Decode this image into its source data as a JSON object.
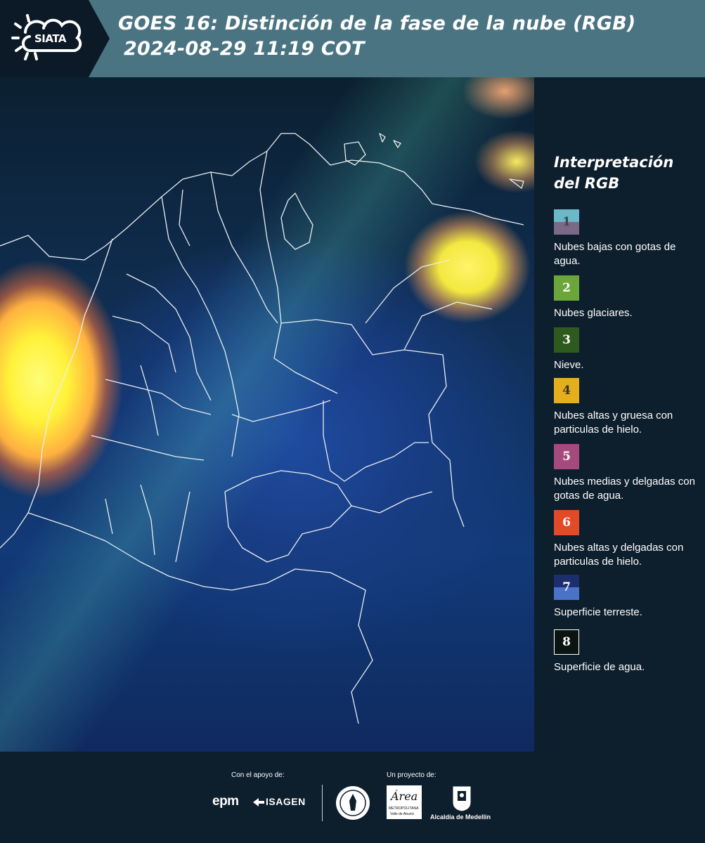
{
  "header": {
    "logo_text": "SIATA",
    "title_line1": "GOES 16: Distinción de la fase de la nube (RGB)",
    "title_line2": "2024-08-29 11:19 COT"
  },
  "legend": {
    "title_line1": "Interpretación",
    "title_line2": "del RGB",
    "items": [
      {
        "num": "1",
        "label": "Nubes bajas con gotas de agua.",
        "color_top": "#6ab8c8",
        "color_bottom": "#7a6a8a"
      },
      {
        "num": "2",
        "label": "Nubes glaciares.",
        "color_top": "#6aa63a",
        "color_bottom": "#6aa63a"
      },
      {
        "num": "3",
        "label": "Nieve.",
        "color_top": "#2f5a1e",
        "color_bottom": "#2f5a1e"
      },
      {
        "num": "4",
        "label": "Nubes altas y gruesa con particulas de hielo.",
        "color_top": "#e4ae1c",
        "color_bottom": "#e4ae1c"
      },
      {
        "num": "5",
        "label": "Nubes medias y delgadas con gotas de agua.",
        "color_top": "#a64a7e",
        "color_bottom": "#a64a7e"
      },
      {
        "num": "6",
        "label": "Nubes altas y delgadas con particulas de hielo.",
        "color_top": "#e24a28",
        "color_bottom": "#e24a28"
      },
      {
        "num": "7",
        "label": "Superficie terreste.",
        "color_top": "#1c2e6e",
        "color_bottom": "#4a72c8"
      },
      {
        "num": "8",
        "label": "Superficie de agua.",
        "color_top": "#0a1410",
        "color_bottom": "#0a1410"
      }
    ]
  },
  "footer": {
    "support_label": "Con el apoyo de:",
    "project_label": "Un proyecto de:",
    "epm": "epm",
    "isagen": "ISAGEN",
    "area_text": "Área",
    "area_sub": "METROPOLITANA",
    "area_sub2": "Valle de Aburrá",
    "alcaldia": "Alcaldía de Medellín"
  }
}
